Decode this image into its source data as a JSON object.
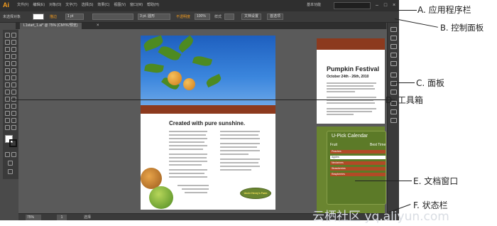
{
  "app": {
    "logo": "Ai",
    "menu": [
      "文件(F)",
      "编辑(E)",
      "对象(O)",
      "文字(T)",
      "选择(S)",
      "效果(C)",
      "视图(V)",
      "窗口(W)",
      "帮助(H)"
    ],
    "workspace": "基本功能",
    "win_min": "–",
    "win_max": "□",
    "win_close": "×"
  },
  "control_panel": {
    "selection_label": "未选择对象",
    "stroke_label": "描边",
    "stroke_value": "1 pt",
    "brush_value": "3 pt. 圆形",
    "opacity_label": "不透明度",
    "opacity_value": "100%",
    "style_label": "样式",
    "doc_setup_button": "文档设置",
    "prefs_button": "首选项"
  },
  "document": {
    "tab_label": "L1start_1.ai* @ 75% (CMYK/预览)",
    "tab_close": "×"
  },
  "artwork": {
    "page1": {
      "title": "Created with pure sunshine.",
      "badge": "Uncle Henry's Farm"
    },
    "page2": {
      "title": "Pumpkin Festival",
      "date": "October 24th - 26th, 2010"
    },
    "page3": {
      "title": "U-Pick Calendar",
      "col_fruit": "Fruit",
      "col_time": "Best Time",
      "rows": [
        "Peaches",
        "Apples",
        "Nectarines",
        "Strawberries",
        "Raspberries"
      ]
    }
  },
  "status_bar": {
    "zoom": "75%",
    "page": "1",
    "selection": "选择"
  },
  "callouts": {
    "A": "A. 应用程序栏",
    "B": "B. 控制面板",
    "C": "C. 面板",
    "D": "D. 工具箱",
    "E": "E. 文档窗口",
    "F": "F. 状态栏"
  },
  "watermark": "云栖社区 yq.aliyun.com"
}
